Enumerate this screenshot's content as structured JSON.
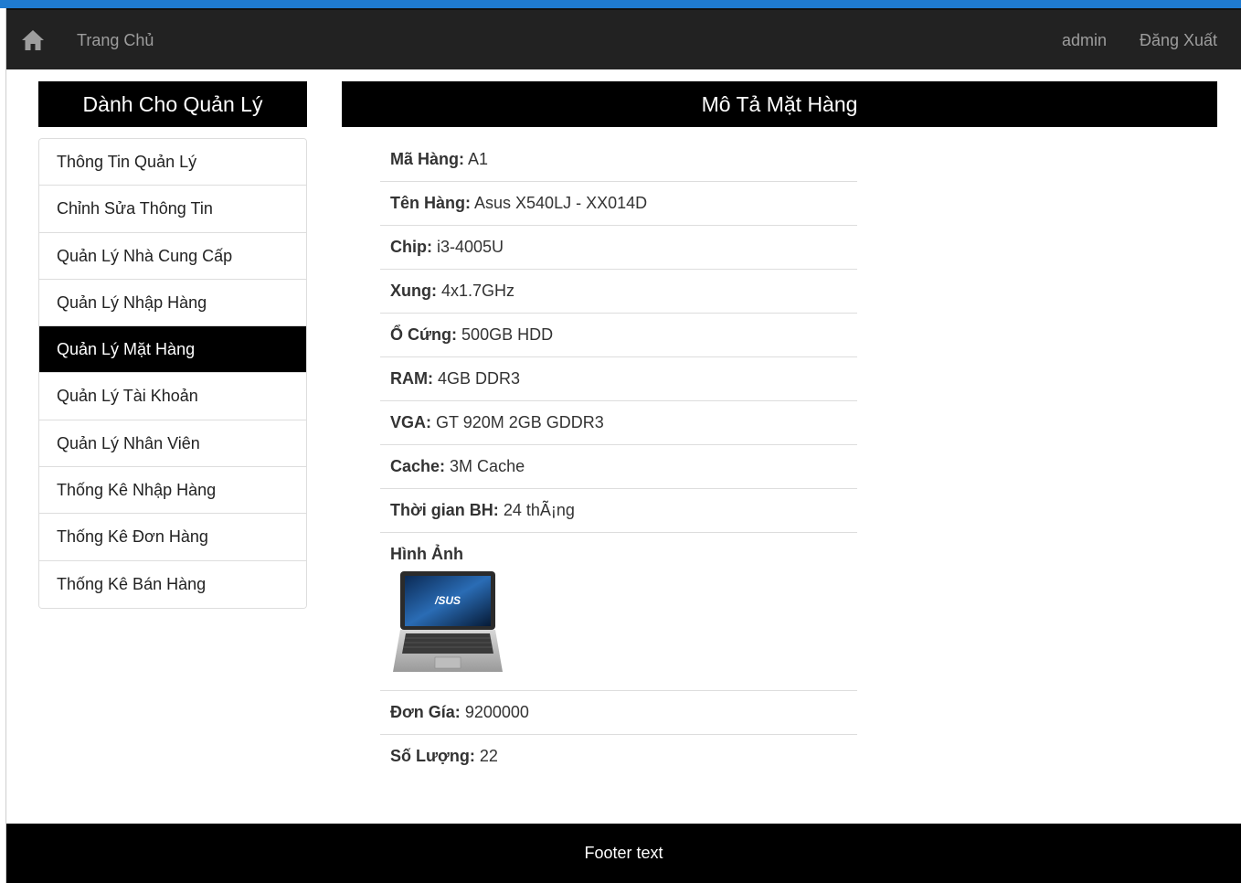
{
  "navbar": {
    "home_icon": "home-icon",
    "home_label": "Trang Chủ",
    "user_label": "admin",
    "logout_label": "Đăng Xuất"
  },
  "sidebar": {
    "title": "Dành Cho Quản Lý",
    "items": [
      {
        "label": "Thông Tin Quản Lý"
      },
      {
        "label": "Chỉnh Sửa Thông Tin"
      },
      {
        "label": "Quản Lý Nhà Cung Cấp"
      },
      {
        "label": "Quản Lý Nhập Hàng"
      },
      {
        "label": "Quản Lý Mặt Hàng"
      },
      {
        "label": "Quản Lý Tài Khoản"
      },
      {
        "label": "Quản Lý Nhân Viên"
      },
      {
        "label": "Thống Kê Nhập Hàng"
      },
      {
        "label": "Thống Kê Đơn Hàng"
      },
      {
        "label": "Thống Kê Bán Hàng"
      }
    ],
    "active_index": 4
  },
  "main": {
    "title": "Mô Tả Mặt Hàng",
    "fields": [
      {
        "label": "Mã Hàng:",
        "value": "A1"
      },
      {
        "label": "Tên Hàng:",
        "value": "Asus X540LJ - XX014D"
      },
      {
        "label": "Chip:",
        "value": "i3-4005U"
      },
      {
        "label": "Xung:",
        "value": "4x1.7GHz"
      },
      {
        "label": "Ổ Cứng:",
        "value": "500GB HDD"
      },
      {
        "label": "RAM:",
        "value": "4GB DDR3"
      },
      {
        "label": "VGA:",
        "value": "GT 920M 2GB GDDR3"
      },
      {
        "label": "Cache:",
        "value": "3M Cache"
      },
      {
        "label": "Thời gian BH:",
        "value": "24 thÃ¡ng"
      }
    ],
    "image_label": "Hình Ảnh",
    "image_brand": "/SUS",
    "after_fields": [
      {
        "label": "Đơn Gía:",
        "value": "9200000"
      },
      {
        "label": "Số Lượng:",
        "value": "22"
      }
    ]
  },
  "footer": {
    "text": "Footer text"
  },
  "colors": {
    "top_stripe": "#1f7bd0",
    "navbar": "#222222",
    "header_bg": "#000000",
    "active_item": "#000000"
  }
}
